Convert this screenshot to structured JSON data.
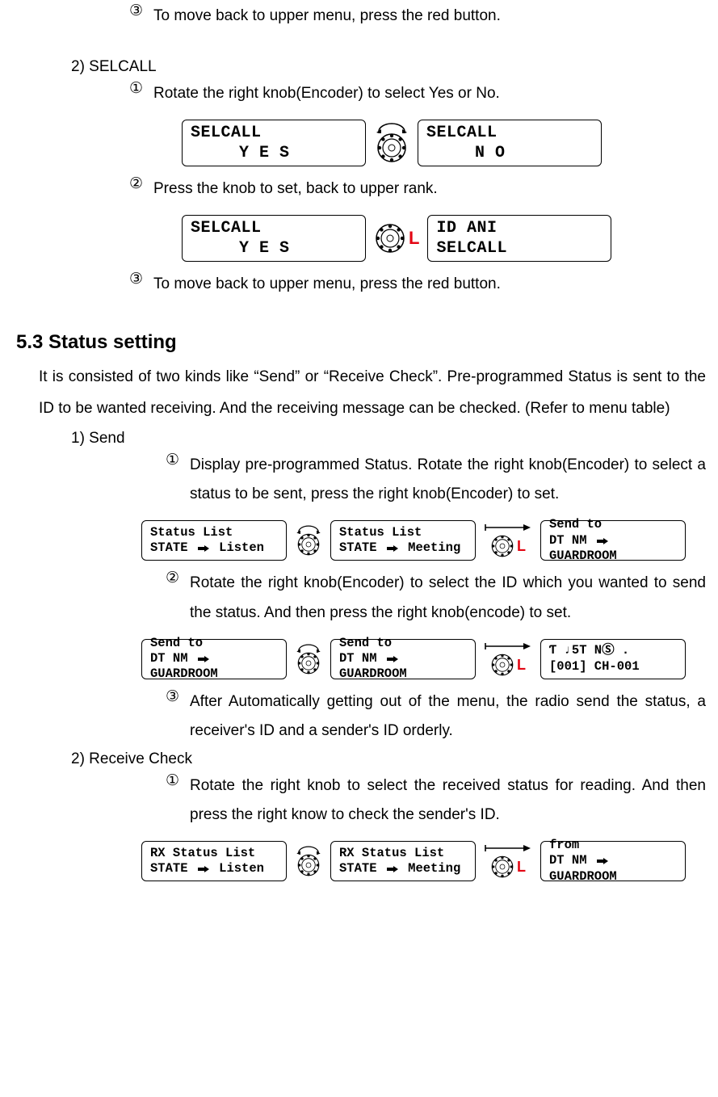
{
  "top_step3": {
    "num": "③",
    "text": "To move back to upper menu, press the red button."
  },
  "selcall": {
    "head": "2)   SELCALL",
    "s1": {
      "num": "①",
      "text": "Rotate the right knob(Encoder) to select Yes or No."
    },
    "lcd1a_l1": "SELCALL",
    "lcd1a_l2": "Y E S",
    "lcd1b_l1": "SELCALL",
    "lcd1b_l2": "N   O",
    "s2": {
      "num": "②",
      "text": " Press the knob to set, back to upper rank."
    },
    "lcd2a_l1": "SELCALL",
    "lcd2a_l2": "Y E S",
    "lcd2b_l1": "ID ANI",
    "lcd2b_l2": "SELCALL",
    "s3": {
      "num": "③",
      "text": "To move back to upper menu, press the red button."
    }
  },
  "section": {
    "title": "5.3 Status setting",
    "para": "It is consisted of two kinds like “Send” or “Receive Check”. Pre-programmed Status is sent to the ID to be wanted receiving. And the receiving message can be checked. (Refer to menu table)"
  },
  "send": {
    "head": "1)   Send",
    "s1": {
      "num": "①",
      "text": "Display pre-programmed Status. Rotate the right knob(Encoder) to select a status to be sent, press the right knob(Encoder) to set."
    },
    "lcdA_l1": "Status List",
    "lcdA_l2a": "STATE",
    "lcdA_l2b": "Listen",
    "lcdB_l1": "Status List",
    "lcdB_l2a": "STATE",
    "lcdB_l2b": "Meeting",
    "lcdC_l1": "Send to",
    "lcdC_l2a": "DT NM",
    "lcdC_l2b": "GUARDROOM",
    "s2": {
      "num": "②",
      "text": "Rotate the right knob(Encoder) to select the ID which you wanted to send the status. And then press the right knob(encode) to set."
    },
    "lcdD_l1": "Send to",
    "lcdD_l2a": "DT NM",
    "lcdD_l2b": "GUARDROOM",
    "lcdE_l1": "Send to",
    "lcdE_l2a": "DT NM",
    "lcdE_l2b": "GUARDROOM",
    "lcdF_l1": "Ƭ ♩5T   NⓈ  .",
    "lcdF_l2": "[001]  CH-001",
    "s3": {
      "num": "③",
      "text": "After Automatically getting out of the menu, the radio send the status, a receiver's ID and a sender's ID orderly."
    }
  },
  "recv": {
    "head": "2)   Receive Check",
    "s1": {
      "num": "①",
      "text": "Rotate the right knob to select the received status for reading. And then press the right know to check the sender's ID."
    },
    "lcdA_l1": "RX Status List",
    "lcdA_l2a": "STATE",
    "lcdA_l2b": "Listen",
    "lcdB_l1": "RX Status List",
    "lcdB_l2a": "STATE",
    "lcdB_l2b": "Meeting",
    "lcdC_l1": "from",
    "lcdC_l2a": "DT NM",
    "lcdC_l2b": "GUARDROOM"
  }
}
